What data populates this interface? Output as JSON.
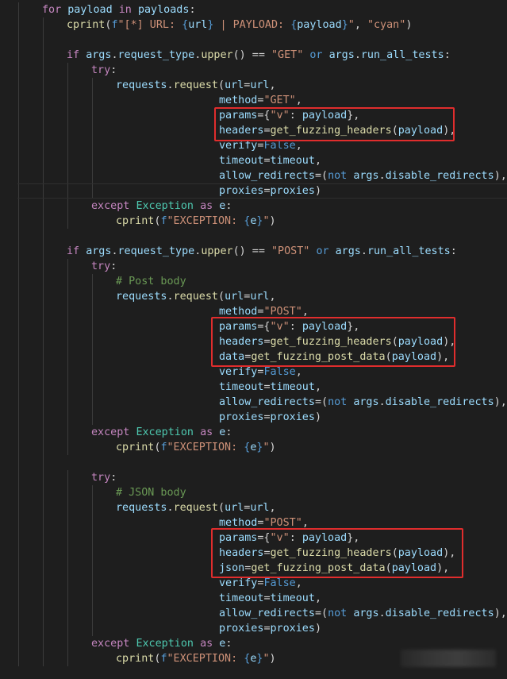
{
  "editor": {
    "theme_colors": {
      "background": "#1e1e1e",
      "keyword": "#569cd6",
      "control": "#c586c0",
      "class": "#4ec9b0",
      "function": "#dcdcaa",
      "variable": "#9cdcfe",
      "string": "#ce9178",
      "comment": "#6a9955",
      "highlight_box": "#e02d2d"
    },
    "lines": [
      [
        [
          "ctl",
          "for"
        ],
        [
          "op",
          " "
        ],
        [
          "var",
          "payload"
        ],
        [
          "op",
          " "
        ],
        [
          "ctl",
          "in"
        ],
        [
          "op",
          " "
        ],
        [
          "var",
          "payloads"
        ],
        [
          "op",
          ":"
        ]
      ],
      [
        [
          "fn",
          "cprint"
        ],
        [
          "op",
          "("
        ],
        [
          "kw",
          "f"
        ],
        [
          "str",
          "\"[*] URL: "
        ],
        [
          "brace",
          "{"
        ],
        [
          "var",
          "url"
        ],
        [
          "brace",
          "}"
        ],
        [
          "str",
          " | PAYLOAD: "
        ],
        [
          "brace",
          "{"
        ],
        [
          "var",
          "payload"
        ],
        [
          "brace",
          "}"
        ],
        [
          "str",
          "\""
        ],
        [
          "op",
          ", "
        ],
        [
          "str",
          "\"cyan\""
        ],
        [
          "op",
          ")"
        ]
      ],
      [],
      [
        [
          "ctl",
          "if"
        ],
        [
          "op",
          " "
        ],
        [
          "var",
          "args"
        ],
        [
          "op",
          "."
        ],
        [
          "var",
          "request_type"
        ],
        [
          "op",
          "."
        ],
        [
          "fn",
          "upper"
        ],
        [
          "op",
          "() == "
        ],
        [
          "str",
          "\"GET\""
        ],
        [
          "op",
          " "
        ],
        [
          "kw",
          "or"
        ],
        [
          "op",
          " "
        ],
        [
          "var",
          "args"
        ],
        [
          "op",
          "."
        ],
        [
          "var",
          "run_all_tests"
        ],
        [
          "op",
          ":"
        ]
      ],
      [
        [
          "ctl",
          "try"
        ],
        [
          "op",
          ":"
        ]
      ],
      [
        [
          "var",
          "requests"
        ],
        [
          "op",
          "."
        ],
        [
          "fn",
          "request"
        ],
        [
          "op",
          "("
        ],
        [
          "var",
          "url"
        ],
        [
          "op",
          "="
        ],
        [
          "var",
          "url"
        ],
        [
          "op",
          ","
        ]
      ],
      [
        [
          "var",
          "method"
        ],
        [
          "op",
          "="
        ],
        [
          "str",
          "\"GET\""
        ],
        [
          "op",
          ","
        ]
      ],
      [
        [
          "var",
          "params"
        ],
        [
          "op",
          "={"
        ],
        [
          "str",
          "\"v\""
        ],
        [
          "op",
          ": "
        ],
        [
          "var",
          "payload"
        ],
        [
          "op",
          "},"
        ]
      ],
      [
        [
          "var",
          "headers"
        ],
        [
          "op",
          "="
        ],
        [
          "fn",
          "get_fuzzing_headers"
        ],
        [
          "op",
          "("
        ],
        [
          "var",
          "payload"
        ],
        [
          "op",
          "),"
        ]
      ],
      [
        [
          "var",
          "verify"
        ],
        [
          "op",
          "="
        ],
        [
          "kw",
          "False"
        ],
        [
          "op",
          ","
        ]
      ],
      [
        [
          "var",
          "timeout"
        ],
        [
          "op",
          "="
        ],
        [
          "var",
          "timeout"
        ],
        [
          "op",
          ","
        ]
      ],
      [
        [
          "var",
          "allow_redirects"
        ],
        [
          "op",
          "=("
        ],
        [
          "kw",
          "not"
        ],
        [
          "op",
          " "
        ],
        [
          "var",
          "args"
        ],
        [
          "op",
          "."
        ],
        [
          "var",
          "disable_redirects"
        ],
        [
          "op",
          "),"
        ]
      ],
      [
        [
          "var",
          "proxies"
        ],
        [
          "op",
          "="
        ],
        [
          "var",
          "proxies"
        ],
        [
          "op",
          ")"
        ]
      ],
      [
        [
          "ctl",
          "except"
        ],
        [
          "op",
          " "
        ],
        [
          "cls",
          "Exception"
        ],
        [
          "op",
          " "
        ],
        [
          "ctl",
          "as"
        ],
        [
          "op",
          " "
        ],
        [
          "var",
          "e"
        ],
        [
          "op",
          ":"
        ]
      ],
      [
        [
          "fn",
          "cprint"
        ],
        [
          "op",
          "("
        ],
        [
          "kw",
          "f"
        ],
        [
          "str",
          "\"EXCEPTION: "
        ],
        [
          "brace",
          "{"
        ],
        [
          "var",
          "e"
        ],
        [
          "brace",
          "}"
        ],
        [
          "str",
          "\""
        ],
        [
          "op",
          ")"
        ]
      ],
      [],
      [
        [
          "ctl",
          "if"
        ],
        [
          "op",
          " "
        ],
        [
          "var",
          "args"
        ],
        [
          "op",
          "."
        ],
        [
          "var",
          "request_type"
        ],
        [
          "op",
          "."
        ],
        [
          "fn",
          "upper"
        ],
        [
          "op",
          "() == "
        ],
        [
          "str",
          "\"POST\""
        ],
        [
          "op",
          " "
        ],
        [
          "kw",
          "or"
        ],
        [
          "op",
          " "
        ],
        [
          "var",
          "args"
        ],
        [
          "op",
          "."
        ],
        [
          "var",
          "run_all_tests"
        ],
        [
          "op",
          ":"
        ]
      ],
      [
        [
          "ctl",
          "try"
        ],
        [
          "op",
          ":"
        ]
      ],
      [
        [
          "com",
          "# Post body"
        ]
      ],
      [
        [
          "var",
          "requests"
        ],
        [
          "op",
          "."
        ],
        [
          "fn",
          "request"
        ],
        [
          "op",
          "("
        ],
        [
          "var",
          "url"
        ],
        [
          "op",
          "="
        ],
        [
          "var",
          "url"
        ],
        [
          "op",
          ","
        ]
      ],
      [
        [
          "var",
          "method"
        ],
        [
          "op",
          "="
        ],
        [
          "str",
          "\"POST\""
        ],
        [
          "op",
          ","
        ]
      ],
      [
        [
          "var",
          "params"
        ],
        [
          "op",
          "={"
        ],
        [
          "str",
          "\"v\""
        ],
        [
          "op",
          ": "
        ],
        [
          "var",
          "payload"
        ],
        [
          "op",
          "},"
        ]
      ],
      [
        [
          "var",
          "headers"
        ],
        [
          "op",
          "="
        ],
        [
          "fn",
          "get_fuzzing_headers"
        ],
        [
          "op",
          "("
        ],
        [
          "var",
          "payload"
        ],
        [
          "op",
          "),"
        ]
      ],
      [
        [
          "var",
          "data"
        ],
        [
          "op",
          "="
        ],
        [
          "fn",
          "get_fuzzing_post_data"
        ],
        [
          "op",
          "("
        ],
        [
          "var",
          "payload"
        ],
        [
          "op",
          "),"
        ]
      ],
      [
        [
          "var",
          "verify"
        ],
        [
          "op",
          "="
        ],
        [
          "kw",
          "False"
        ],
        [
          "op",
          ","
        ]
      ],
      [
        [
          "var",
          "timeout"
        ],
        [
          "op",
          "="
        ],
        [
          "var",
          "timeout"
        ],
        [
          "op",
          ","
        ]
      ],
      [
        [
          "var",
          "allow_redirects"
        ],
        [
          "op",
          "=("
        ],
        [
          "kw",
          "not"
        ],
        [
          "op",
          " "
        ],
        [
          "var",
          "args"
        ],
        [
          "op",
          "."
        ],
        [
          "var",
          "disable_redirects"
        ],
        [
          "op",
          "),"
        ]
      ],
      [
        [
          "var",
          "proxies"
        ],
        [
          "op",
          "="
        ],
        [
          "var",
          "proxies"
        ],
        [
          "op",
          ")"
        ]
      ],
      [
        [
          "ctl",
          "except"
        ],
        [
          "op",
          " "
        ],
        [
          "cls",
          "Exception"
        ],
        [
          "op",
          " "
        ],
        [
          "ctl",
          "as"
        ],
        [
          "op",
          " "
        ],
        [
          "var",
          "e"
        ],
        [
          "op",
          ":"
        ]
      ],
      [
        [
          "fn",
          "cprint"
        ],
        [
          "op",
          "("
        ],
        [
          "kw",
          "f"
        ],
        [
          "str",
          "\"EXCEPTION: "
        ],
        [
          "brace",
          "{"
        ],
        [
          "var",
          "e"
        ],
        [
          "brace",
          "}"
        ],
        [
          "str",
          "\""
        ],
        [
          "op",
          ")"
        ]
      ],
      [],
      [
        [
          "ctl",
          "try"
        ],
        [
          "op",
          ":"
        ]
      ],
      [
        [
          "com",
          "# JSON body"
        ]
      ],
      [
        [
          "var",
          "requests"
        ],
        [
          "op",
          "."
        ],
        [
          "fn",
          "request"
        ],
        [
          "op",
          "("
        ],
        [
          "var",
          "url"
        ],
        [
          "op",
          "="
        ],
        [
          "var",
          "url"
        ],
        [
          "op",
          ","
        ]
      ],
      [
        [
          "var",
          "method"
        ],
        [
          "op",
          "="
        ],
        [
          "str",
          "\"POST\""
        ],
        [
          "op",
          ","
        ]
      ],
      [
        [
          "var",
          "params"
        ],
        [
          "op",
          "={"
        ],
        [
          "str",
          "\"v\""
        ],
        [
          "op",
          ": "
        ],
        [
          "var",
          "payload"
        ],
        [
          "op",
          "},"
        ]
      ],
      [
        [
          "var",
          "headers"
        ],
        [
          "op",
          "="
        ],
        [
          "fn",
          "get_fuzzing_headers"
        ],
        [
          "op",
          "("
        ],
        [
          "var",
          "payload"
        ],
        [
          "op",
          "),"
        ]
      ],
      [
        [
          "var",
          "json"
        ],
        [
          "op",
          "="
        ],
        [
          "fn",
          "get_fuzzing_post_data"
        ],
        [
          "op",
          "("
        ],
        [
          "var",
          "payload"
        ],
        [
          "op",
          "),"
        ]
      ],
      [
        [
          "var",
          "verify"
        ],
        [
          "op",
          "="
        ],
        [
          "kw",
          "False"
        ],
        [
          "op",
          ","
        ]
      ],
      [
        [
          "var",
          "timeout"
        ],
        [
          "op",
          "="
        ],
        [
          "var",
          "timeout"
        ],
        [
          "op",
          ","
        ]
      ],
      [
        [
          "var",
          "allow_redirects"
        ],
        [
          "op",
          "=("
        ],
        [
          "kw",
          "not"
        ],
        [
          "op",
          " "
        ],
        [
          "var",
          "args"
        ],
        [
          "op",
          "."
        ],
        [
          "var",
          "disable_redirects"
        ],
        [
          "op",
          "),"
        ]
      ],
      [
        [
          "var",
          "proxies"
        ],
        [
          "op",
          "="
        ],
        [
          "var",
          "proxies"
        ],
        [
          "op",
          ")"
        ]
      ],
      [
        [
          "ctl",
          "except"
        ],
        [
          "op",
          " "
        ],
        [
          "cls",
          "Exception"
        ],
        [
          "op",
          " "
        ],
        [
          "ctl",
          "as"
        ],
        [
          "op",
          " "
        ],
        [
          "var",
          "e"
        ],
        [
          "op",
          ":"
        ]
      ],
      [
        [
          "fn",
          "cprint"
        ],
        [
          "op",
          "("
        ],
        [
          "kw",
          "f"
        ],
        [
          "str",
          "\"EXCEPTION: "
        ],
        [
          "brace",
          "{"
        ],
        [
          "var",
          "e"
        ],
        [
          "brace",
          "}"
        ],
        [
          "str",
          "\""
        ],
        [
          "op",
          ")"
        ]
      ]
    ]
  }
}
